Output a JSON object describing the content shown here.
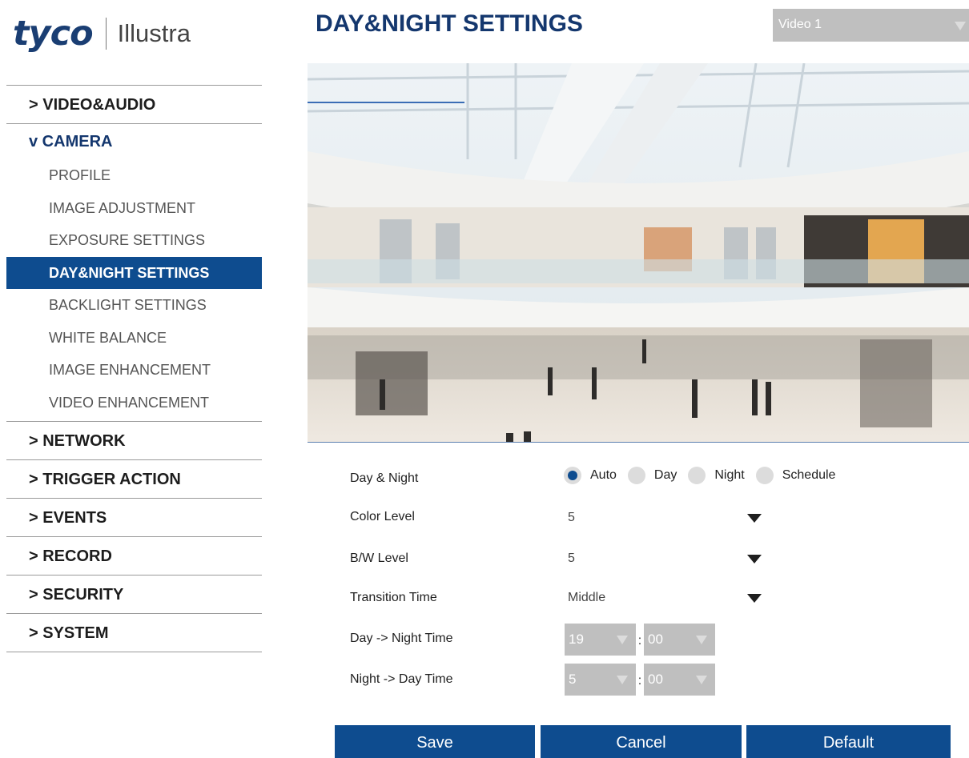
{
  "logo": {
    "brand": "tyco",
    "product": "Illustra"
  },
  "page_title": "DAY&NIGHT SETTINGS",
  "video_select": {
    "value": "Video 1"
  },
  "sidebar": {
    "sections_top": [
      {
        "label": "> VIDEO&AUDIO"
      }
    ],
    "open_section": {
      "label": "v CAMERA",
      "items": [
        {
          "label": "PROFILE"
        },
        {
          "label": "IMAGE ADJUSTMENT"
        },
        {
          "label": "EXPOSURE SETTINGS"
        },
        {
          "label": "DAY&NIGHT SETTINGS",
          "active": true
        },
        {
          "label": "BACKLIGHT SETTINGS"
        },
        {
          "label": "WHITE BALANCE"
        },
        {
          "label": "IMAGE ENHANCEMENT"
        },
        {
          "label": "VIDEO ENHANCEMENT"
        }
      ]
    },
    "sections_bottom": [
      {
        "label": "> NETWORK"
      },
      {
        "label": "> TRIGGER ACTION"
      },
      {
        "label": "> EVENTS"
      },
      {
        "label": "> RECORD"
      },
      {
        "label": "> SECURITY"
      },
      {
        "label": "> SYSTEM"
      }
    ]
  },
  "form": {
    "day_night": {
      "label": "Day & Night",
      "options": [
        "Auto",
        "Day",
        "Night",
        "Schedule"
      ],
      "selected": "Auto"
    },
    "color_level": {
      "label": "Color Level",
      "value": "5"
    },
    "bw_level": {
      "label": "B/W Level",
      "value": "5"
    },
    "transition_time": {
      "label": "Transition Time",
      "value": "Middle"
    },
    "day_to_night": {
      "label": "Day -> Night Time",
      "hour": "19",
      "minute": "00",
      "separator": ":"
    },
    "night_to_day": {
      "label": "Night -> Day Time",
      "hour": "5",
      "minute": "00",
      "separator": ":"
    }
  },
  "buttons": {
    "save": "Save",
    "cancel": "Cancel",
    "default": "Default"
  },
  "colors": {
    "brand_blue": "#0e4c8f",
    "title_blue": "#14376e",
    "disabled_gray": "#bfbfbf"
  }
}
